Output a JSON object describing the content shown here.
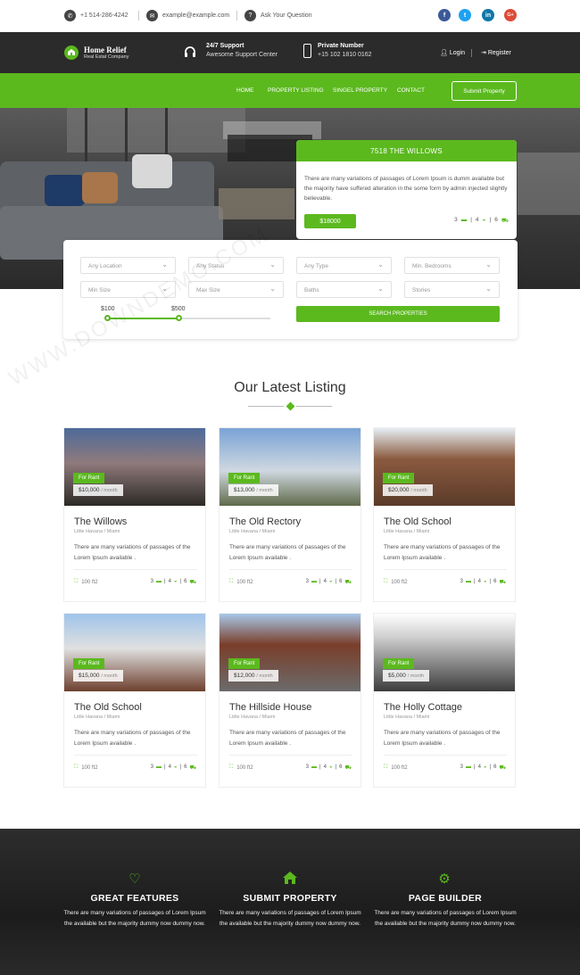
{
  "topbar": {
    "phone": "+1 514-286-4242",
    "email": "example@example.com",
    "ask": "Ask Your Question",
    "social": [
      "f",
      "t",
      "in",
      "G+"
    ],
    "social_colors": [
      "#3b5998",
      "#1da1f2",
      "#0e76a8",
      "#dd4b39"
    ]
  },
  "header": {
    "logo_title": "Home Relief",
    "logo_subtitle": "Real Estat Company",
    "support_title": "24/7 Support",
    "support_sub": "Awesome Support Center",
    "private_title": "Private Number",
    "private_sub": "+15 102 1810 0162",
    "login": "Login",
    "register": "Register"
  },
  "nav": {
    "items": [
      "HOME",
      "PROPERTY LISTING",
      "SINGEL PROPERTY",
      "CONTACT"
    ],
    "submit": "Submit Property"
  },
  "featured": {
    "title": "7518 THE WILLOWS",
    "desc": "There are many variations of passages of Lorem Ipsum is dumm available but the majority have suffered alteration in the some form by admin injected slightly believable.",
    "price": "$18000",
    "beds": "3",
    "baths": "4",
    "garage": "6"
  },
  "search": {
    "fields": [
      "Any Location",
      "Any Status",
      "Any Type",
      "Min. Bedrooms",
      "Min Size",
      "Max Size",
      "Baths",
      "Stories"
    ],
    "min": "$100",
    "max": "$500",
    "button": "SEARCH PROPERTIES"
  },
  "latest": {
    "title": "Our Latest Listing"
  },
  "listings": [
    {
      "title": "The Willows",
      "loc": "Little Havana / Miami",
      "price": "$10,000",
      "per": "/ month",
      "badge": "For Rant",
      "desc": "There are many variations of passages of the Lorem Ipsum available .",
      "area": "100 ft2",
      "beds": "3",
      "baths": "4",
      "garage": "6"
    },
    {
      "title": "The Old Rectory",
      "loc": "Little Havana / Miami",
      "price": "$13,000",
      "per": "/ month",
      "badge": "For Rant",
      "desc": "There are many variations of passages of the Lorem Ipsum available .",
      "area": "100 ft2",
      "beds": "3",
      "baths": "4",
      "garage": "6"
    },
    {
      "title": "The Old School",
      "loc": "Little Havana / Miami",
      "price": "$20,000",
      "per": "/ month",
      "badge": "For Rant",
      "desc": "There are many variations of passages of the Lorem Ipsum available .",
      "area": "100 ft2",
      "beds": "3",
      "baths": "4",
      "garage": "6"
    },
    {
      "title": "The Old School",
      "loc": "Little Havana / Miami",
      "price": "$15,000",
      "per": "/ month",
      "badge": "For Rant",
      "desc": "There are many variations of passages of the Lorem Ipsum available .",
      "area": "100 ft2",
      "beds": "3",
      "baths": "4",
      "garage": "6"
    },
    {
      "title": "The Hillside House",
      "loc": "Little Havana / Miami",
      "price": "$12,000",
      "per": "/ month",
      "badge": "For Rant",
      "desc": "There are many variations of passages of the Lorem Ipsum available .",
      "area": "100 ft2",
      "beds": "3",
      "baths": "4",
      "garage": "6"
    },
    {
      "title": "The Holly Cottage",
      "loc": "Little Havana / Miami",
      "price": "$5,000",
      "per": "/ month",
      "badge": "For Rant",
      "desc": "There are many variations of passages of the Lorem Ipsum available .",
      "area": "100 ft2",
      "beds": "3",
      "baths": "4",
      "garage": "6"
    }
  ],
  "features": [
    {
      "icon": "heart-icon",
      "title": "GREAT FEATURES",
      "desc": "There are many variations of passages of Lorem Ipsum the available but the majority dummy now dummy now."
    },
    {
      "icon": "home-icon",
      "title": "SUBMIT PROPERTY",
      "desc": "There are many variations of passages of Lorem Ipsum the available but the majority dummy now dummy now."
    },
    {
      "icon": "gears-icon",
      "title": "PAGE BUILDER",
      "desc": "There are many variations of passages of Lorem Ipsum the available but the majority dummy now dummy now."
    }
  ],
  "watermark": "WWW.DOWNDEMO.COM",
  "colors": {
    "accent": "#5bb91e",
    "header": "#2b2b2b"
  }
}
